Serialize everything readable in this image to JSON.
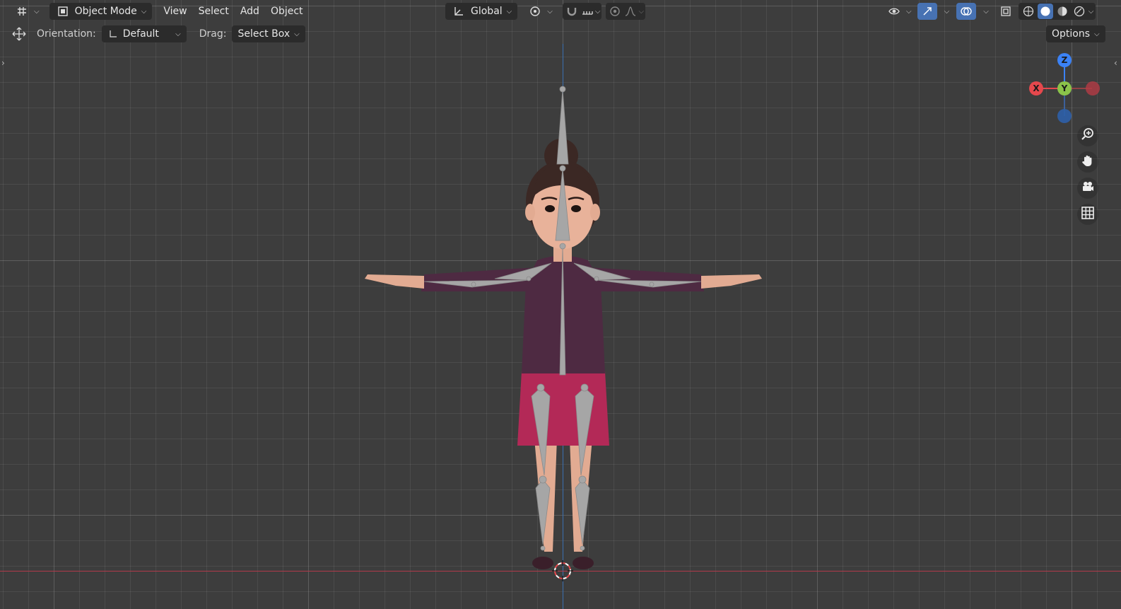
{
  "header": {
    "editor_type_icon": "grid-editor-icon",
    "mode": {
      "icon": "object-mode-icon",
      "label": "Object Mode"
    },
    "menus": [
      "View",
      "Select",
      "Add",
      "Object"
    ],
    "transform_orientation": {
      "icon": "orientation-axes-icon",
      "label": "Global"
    },
    "pivot_icon": "pivot-point-icon",
    "snap_icons": [
      "magnet-icon",
      "snap-increment-icon"
    ],
    "proportional_icons": [
      "proportional-edit-icon",
      "falloff-curve-icon"
    ],
    "right_icons": [
      "visibility-eye-icon",
      "gizmo-icon",
      "overlays-icon",
      "xray-icon"
    ],
    "shading_modes": [
      "wireframe",
      "solid",
      "material-preview",
      "rendered"
    ],
    "active_shading": "solid"
  },
  "toolbar": {
    "tool_icon": "move-tool-icon",
    "orientation_label": "Orientation:",
    "orientation_value": "Default",
    "drag_label": "Drag:",
    "drag_value": "Select Box",
    "options_label": "Options"
  },
  "gizmo": {
    "z_label": "Z",
    "y_label": "Y",
    "x_label": "X",
    "colors": {
      "x": "#e5484d",
      "y": "#8bc34a",
      "z": "#3b82f6"
    }
  },
  "nav_buttons": [
    "zoom-icon",
    "pan-hand-icon",
    "camera-icon",
    "perspective-grid-icon"
  ],
  "colors": {
    "viewport_bg": "#3d3d3d",
    "active_accent": "#4772b3",
    "shirt": "#4e2a42",
    "skirt": "#b32957",
    "skin": "#e0a98f",
    "hair": "#3b2824",
    "bones": "#a6a6a6"
  }
}
